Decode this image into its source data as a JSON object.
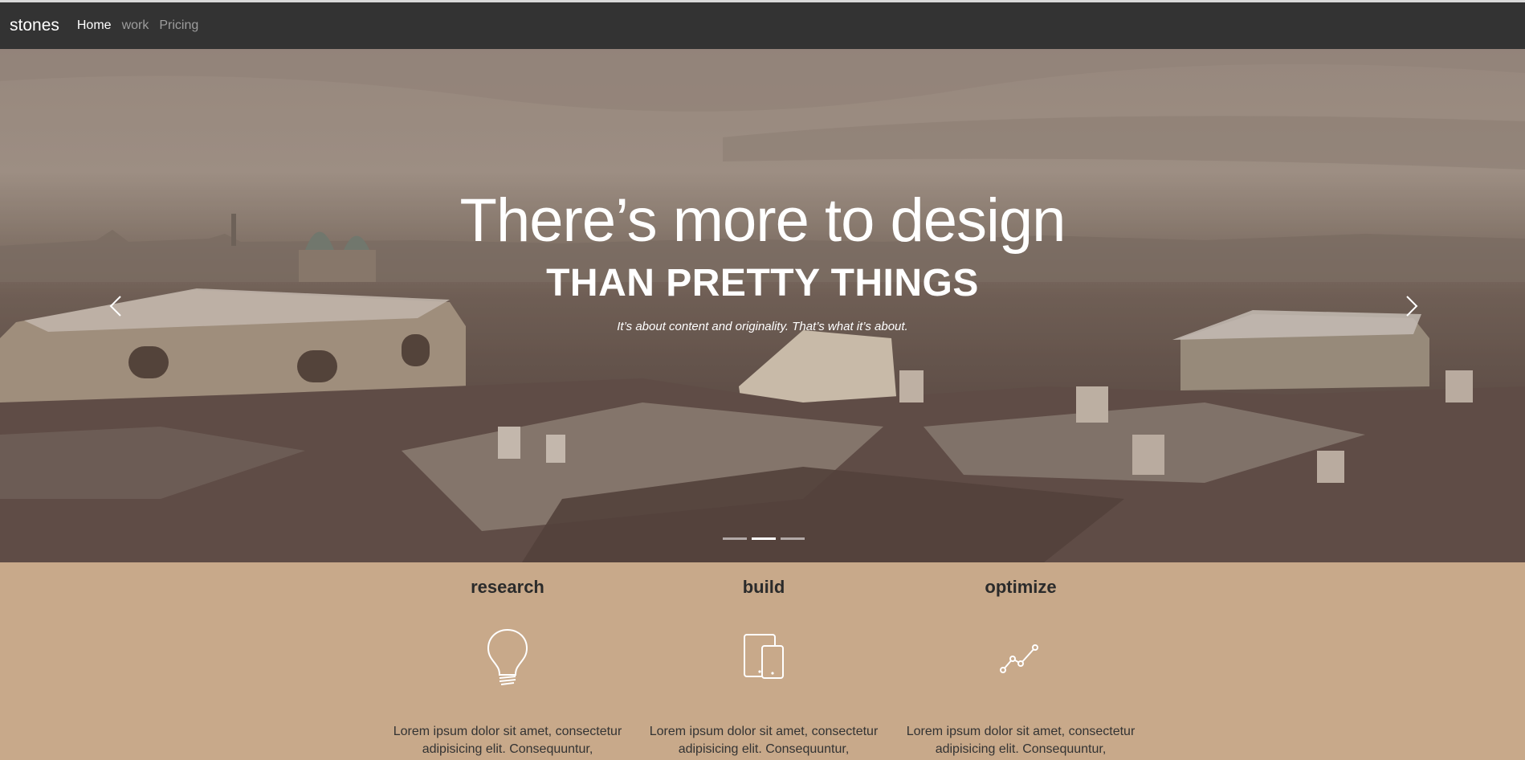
{
  "navbar": {
    "brand": "stones",
    "links": [
      {
        "label": "Home",
        "active": true
      },
      {
        "label": "work",
        "active": false
      },
      {
        "label": "Pricing",
        "active": false
      }
    ]
  },
  "hero": {
    "title": "There’s more to design",
    "subtitle": "THAN PRETTY THINGS",
    "tagline": "It’s about content and originality. That’s what it’s about.",
    "indicators": [
      false,
      true,
      false
    ],
    "prev_icon": "chevron-left-icon",
    "next_icon": "chevron-right-icon"
  },
  "features": [
    {
      "title": "research",
      "icon": "lightbulb-icon",
      "text": "Lorem ipsum dolor sit amet, consectetur adipisicing elit. Consequuntur, quisquam."
    },
    {
      "title": "build",
      "icon": "devices-icon",
      "text": "Lorem ipsum dolor sit amet, consectetur adipisicing elit. Consequuntur, quisquam."
    },
    {
      "title": "optimize",
      "icon": "line-chart-icon",
      "text": "Lorem ipsum dolor sit amet, consectetur adipisicing elit. Consequuntur, quisquam."
    }
  ],
  "colors": {
    "navbar": "#333333",
    "features_bg": "#c8a98a"
  }
}
